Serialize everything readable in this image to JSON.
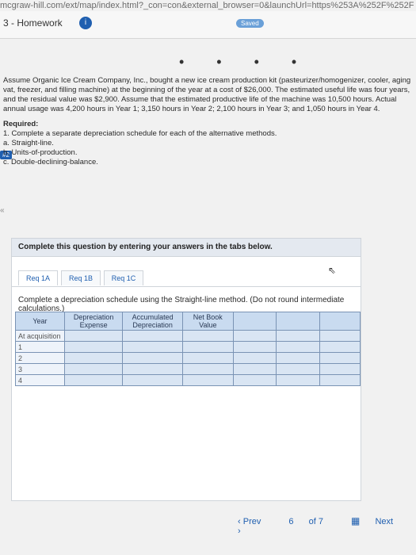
{
  "browser": {
    "url_fragment": "mcgraw-hill.com/ext/map/index.html?_con=con&external_browser=0&launchUrl=https%253A%252F%252F"
  },
  "header": {
    "title": "3 - Homework",
    "info_badge": "i",
    "saved_label": "Saved"
  },
  "problem": {
    "intro": "Assume Organic Ice Cream Company, Inc., bought a new ice cream production kit (pasteurizer/homogenizer, cooler, aging vat, freezer, and filling machine) at the beginning of the year at a cost of $26,000. The estimated useful life was four years, and the residual value was $2,900. Assume that the estimated productive life of the machine was 10,500 hours. Actual annual usage was 4,200 hours in Year 1; 3,150 hours in Year 2; 2,100 hours in Year 3; and 1,050 hours in Year 4.",
    "required_title": "Required:",
    "required_text": "1. Complete a separate depreciation schedule for each of the alternative methods.",
    "methods": [
      "a. Straight-line.",
      "b. Units-of-production.",
      "c. Double-declining-balance."
    ]
  },
  "side_number": "#2",
  "panel": {
    "heading": "Complete this question by entering your answers in the tabs below.",
    "tabs": [
      "Req 1A",
      "Req 1B",
      "Req 1C"
    ],
    "instruction": "Complete a depreciation schedule using the Straight-line method. (Do not round intermediate calculations.)",
    "table": {
      "headers": [
        "Year",
        "Depreciation Expense",
        "Accumulated Depreciation",
        "Net Book Value"
      ],
      "rows": [
        "At acquisition",
        "1",
        "2",
        "3",
        "4"
      ]
    }
  },
  "nav": {
    "prev": "Prev",
    "page": "6",
    "of": "of 7",
    "next": "Next"
  }
}
